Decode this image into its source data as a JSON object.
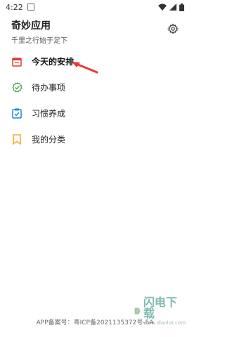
{
  "status_bar": {
    "time": "4:22"
  },
  "header": {
    "title": "奇妙应用",
    "subtitle": "千里之行始于足下"
  },
  "menu": {
    "items": [
      {
        "label": "今天的安排",
        "icon": "calendar-icon",
        "color": "#e53935"
      },
      {
        "label": "待办事项",
        "icon": "todo-check-icon",
        "color": "#43a047"
      },
      {
        "label": "习惯养成",
        "icon": "habit-clipboard-icon",
        "color": "#1e88e5"
      },
      {
        "label": "我的分类",
        "icon": "bookmark-icon",
        "color": "#f9a825"
      }
    ]
  },
  "footer": {
    "icp_text": "APP备案号：粤ICP备2021135372号-5A"
  },
  "watermark": {
    "brand": "闪电下载",
    "site": "www.dianlut.com"
  }
}
